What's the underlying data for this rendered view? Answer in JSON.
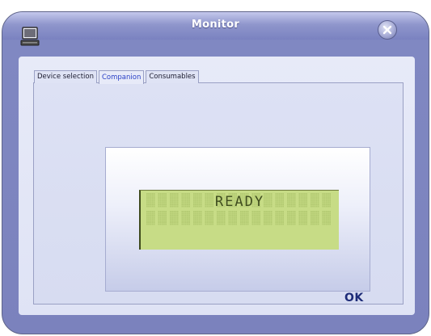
{
  "window": {
    "title": "Monitor",
    "icon": "computer-icon",
    "close_icon": "close-icon"
  },
  "tabs": [
    {
      "label": "Device selection",
      "active": false
    },
    {
      "label": "Companion",
      "active": true
    },
    {
      "label": "Consumables",
      "active": false
    }
  ],
  "display": {
    "status_text": "READY"
  },
  "buttons": {
    "ok_label": "OK"
  },
  "colors": {
    "window_frame": "#7b82bd",
    "panel_background": "#e7eaf8",
    "lcd_background": "#c7dc86",
    "active_tab_text": "#2b41c6",
    "ok_text": "#1e2c78"
  }
}
